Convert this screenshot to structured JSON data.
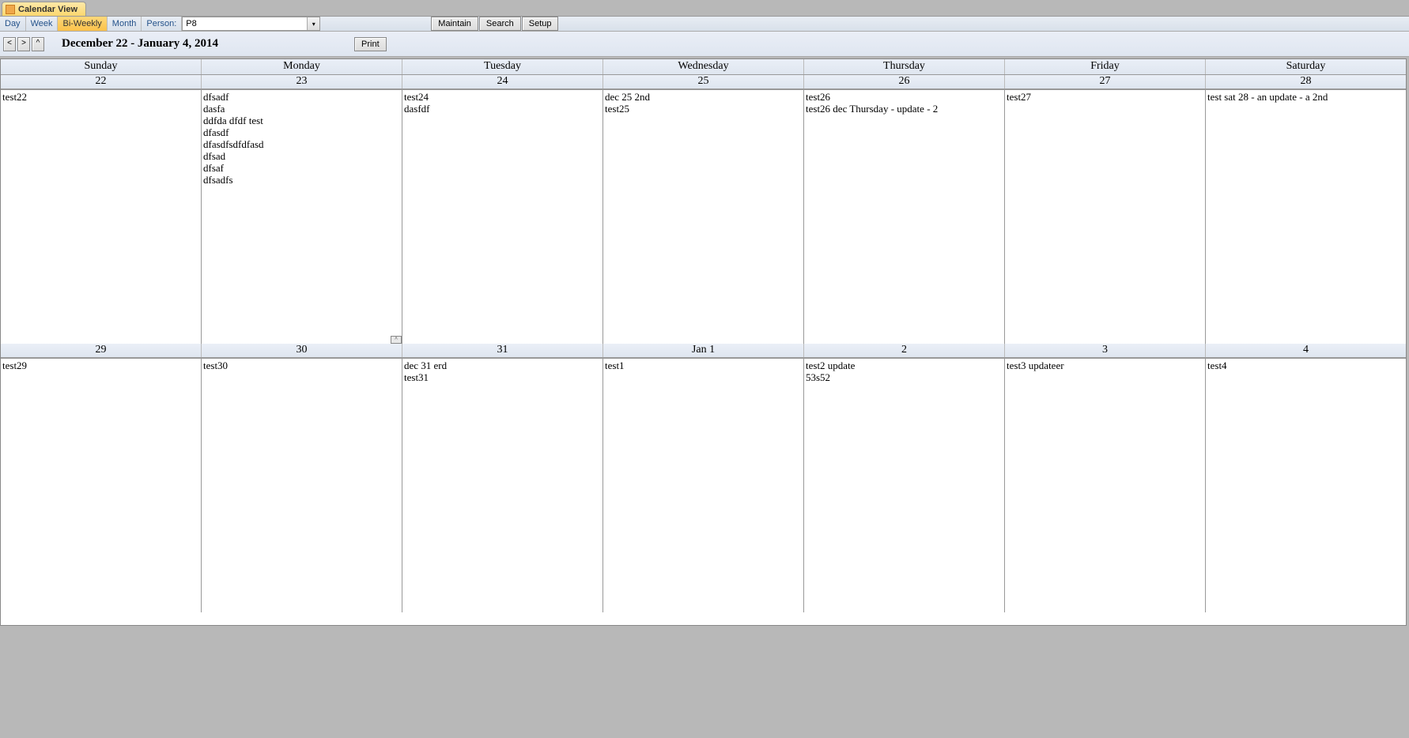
{
  "tab": {
    "title": "Calendar View"
  },
  "toolbar": {
    "views": [
      "Day",
      "Week",
      "Bi-Weekly",
      "Month"
    ],
    "activeView": "Bi-Weekly",
    "personLabel": "Person:",
    "personValue": "P8",
    "maintain": "Maintain",
    "search": "Search",
    "setup": "Setup",
    "navPrev": "<",
    "navNext": ">",
    "navUp": "^",
    "dateRange": "December 22 - January 4, 2014",
    "print": "Print",
    "handleGlyph": "^"
  },
  "dayNames": [
    "Sunday",
    "Monday",
    "Tuesday",
    "Wednesday",
    "Thursday",
    "Friday",
    "Saturday"
  ],
  "weeks": [
    {
      "dates": [
        "22",
        "23",
        "24",
        "25",
        "26",
        "27",
        "28"
      ],
      "events": [
        [
          "test22"
        ],
        [
          "dfsadf",
          "dasfa",
          "ddfda dfdf test",
          "dfasdf",
          "dfasdfsdfdfasd",
          "dfsad",
          "dfsaf",
          "dfsadfs"
        ],
        [
          "test24",
          "dasfdf"
        ],
        [
          "dec 25 2nd",
          "test25"
        ],
        [
          "test26",
          "test26 dec Thursday - update - 2"
        ],
        [
          "test27"
        ],
        [
          "test sat 28 - an update - a 2nd"
        ]
      ],
      "showHandleOnCol": 1
    },
    {
      "dates": [
        "29",
        "30",
        "31",
        "Jan 1",
        "2",
        "3",
        "4"
      ],
      "events": [
        [
          "test29"
        ],
        [
          "test30"
        ],
        [
          "dec 31 erd",
          "test31"
        ],
        [
          "test1"
        ],
        [
          "test2 update",
          "53s52"
        ],
        [
          "test3 updateer"
        ],
        [
          "test4"
        ]
      ]
    }
  ]
}
